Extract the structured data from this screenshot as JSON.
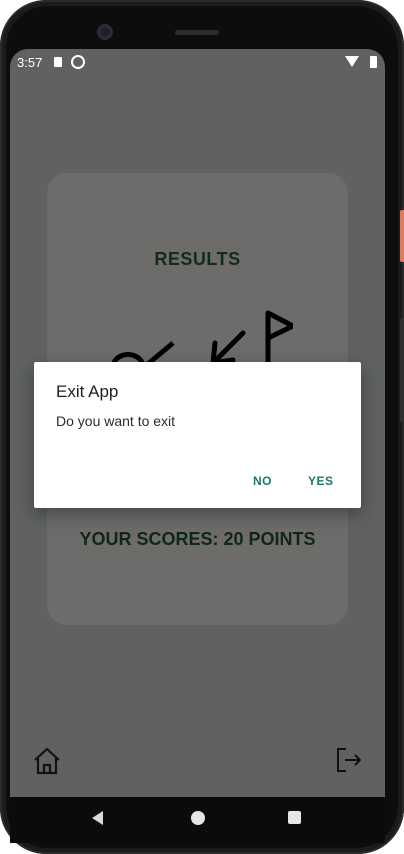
{
  "status_bar": {
    "time": "3:57"
  },
  "results": {
    "title": "RESULTS",
    "scores_text": "YOUR SCORES: 20 POINTS"
  },
  "icons": {
    "home": "home-icon",
    "exit": "exit-icon"
  },
  "dialog": {
    "title": "Exit App",
    "message": "Do you want to exit",
    "no_label": "NO",
    "yes_label": "YES"
  },
  "colors": {
    "screen_bg": "#5f625f",
    "card_bg": "#6e6c6a",
    "title_text": "#142b1a",
    "dialog_button": "#1b7a6a"
  }
}
